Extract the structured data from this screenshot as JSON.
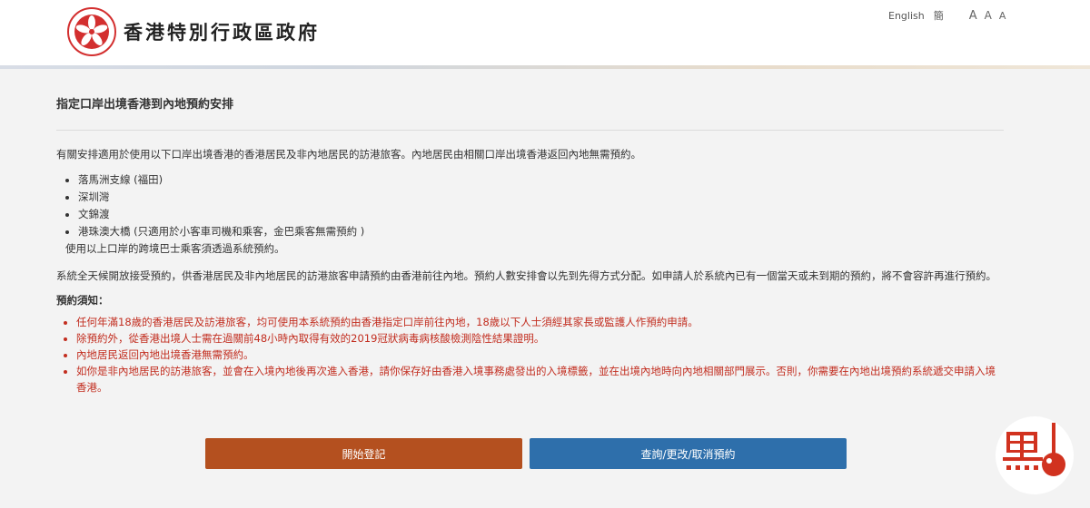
{
  "header": {
    "title": "香港特別行政區政府",
    "lang_en": "English",
    "lang_sc": "簡",
    "font_sizes": [
      "A",
      "A",
      "A"
    ]
  },
  "main": {
    "title": "指定口岸出境香港到內地預約安排",
    "intro": "有關安排適用於使用以下口岸出境香港的香港居民及非內地居民的訪港旅客。內地居民由相關口岸出境香港返回內地無需預約。",
    "ports": [
      "落馬洲支線 (福田)",
      "深圳灣",
      "文錦渡",
      "港珠澳大橋 (只適用於小客車司機和乘客，金巴乘客無需預約 )"
    ],
    "ports_note": "使用以上口岸的跨境巴士乘客須透過系統預約。",
    "system_text": "系統全天候開放接受預約，供香港居民及非內地居民的訪港旅客申請預約由香港前往內地。預約人數安排會以先到先得方式分配。如申請人於系統內已有一個當天或未到期的預約，將不會容許再進行預約。",
    "notice_heading": "預約須知：",
    "notices": [
      "任何年滿18歲的香港居民及訪港旅客，均可使用本系統預約由香港指定口岸前往內地，18歲以下人士須經其家長或監護人作預約申請。",
      "除預約外，從香港出境人士需在過關前48小時內取得有效的2019冠狀病毒病核酸檢測陰性結果證明。",
      "內地居民返回內地出境香港無需預約。",
      "如你是非內地居民的訪港旅客，並會在入境內地後再次進入香港，請你保存好由香港入境事務處發出的入境標籤，並在出境內地時向內地相關部門展示。否則，你需要在內地出境預約系統遞交申請入境香港。"
    ]
  },
  "buttons": {
    "start": "開始登記",
    "query": "查詢/更改/取消預約"
  },
  "colors": {
    "start_button": "#b4501f",
    "query_button": "#2e6fab",
    "notice_text": "#c22d1f",
    "emblem_red": "#d32f2f"
  },
  "icons": {
    "emblem": "hksar-emblem-icon",
    "mascot": "mascot-icon"
  }
}
